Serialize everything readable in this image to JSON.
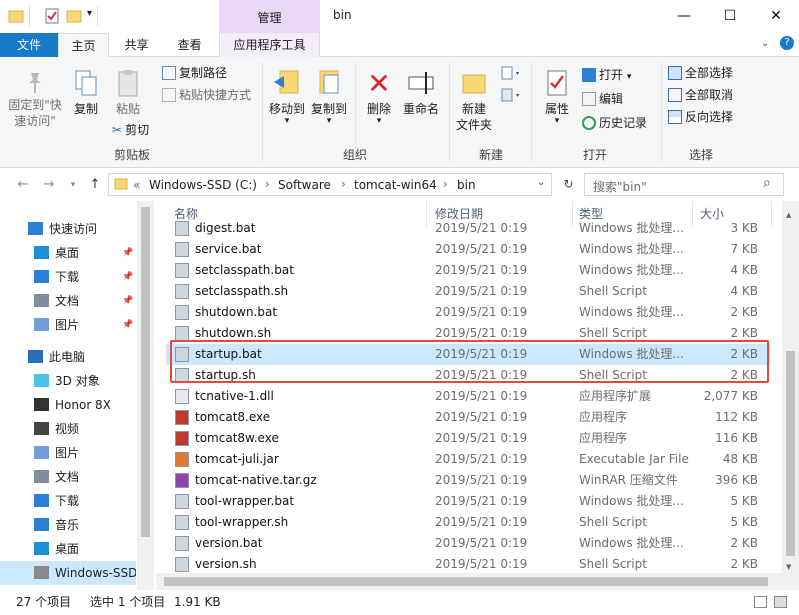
{
  "window": {
    "title": "bin",
    "context_group": "管理",
    "colors": {
      "accent": "#1979ca",
      "context": "#e9d7f6",
      "selection": "#cce8ff",
      "highlight_box": "#e04a3f"
    }
  },
  "tabs": [
    "文件",
    "主页",
    "共享",
    "查看",
    "应用程序工具"
  ],
  "ribbon": {
    "clipboard": {
      "pin": "固定到\"快\n速访问\"",
      "copy": "复制",
      "paste": "粘贴",
      "copy_path": "复制路径",
      "paste_shortcut": "粘贴快捷方式",
      "cut": "剪切",
      "label": "剪贴板"
    },
    "organize": {
      "move_to": "移动到",
      "copy_to": "复制到",
      "delete": "删除",
      "rename": "重命名",
      "label": "组织"
    },
    "new": {
      "new_folder": "新建\n文件夹",
      "label": "新建"
    },
    "open": {
      "properties": "属性",
      "open": "打开",
      "edit": "编辑",
      "history": "历史记录",
      "label": "打开"
    },
    "select": {
      "select_all": "全部选择",
      "select_none": "全部取消",
      "invert": "反向选择",
      "label": "选择"
    }
  },
  "address": {
    "chevron": "«",
    "crumbs": [
      "Windows-SSD (C:)",
      "Software",
      "tomcat-win64",
      "bin"
    ],
    "search_placeholder": "搜索\"bin\""
  },
  "nav": {
    "quick_access": "快速访问",
    "quick_items": [
      "桌面",
      "下载",
      "文档",
      "图片"
    ],
    "this_pc": "此电脑",
    "pc_items": [
      "3D 对象",
      "Honor 8X",
      "视频",
      "图片",
      "文档",
      "下载",
      "音乐",
      "桌面",
      "Windows-SSD"
    ]
  },
  "columns": {
    "name": "名称",
    "date": "修改日期",
    "type": "类型",
    "size": "大小"
  },
  "files": [
    {
      "name": "digest.bat",
      "date": "2019/5/21 0:19",
      "type": "Windows 批处理...",
      "size": "3 KB",
      "icon": "script-icon"
    },
    {
      "name": "service.bat",
      "date": "2019/5/21 0:19",
      "type": "Windows 批处理...",
      "size": "7 KB",
      "icon": "script-icon"
    },
    {
      "name": "setclasspath.bat",
      "date": "2019/5/21 0:19",
      "type": "Windows 批处理...",
      "size": "4 KB",
      "icon": "script-icon"
    },
    {
      "name": "setclasspath.sh",
      "date": "2019/5/21 0:19",
      "type": "Shell Script",
      "size": "4 KB",
      "icon": "script-icon"
    },
    {
      "name": "shutdown.bat",
      "date": "2019/5/21 0:19",
      "type": "Windows 批处理...",
      "size": "2 KB",
      "icon": "script-icon"
    },
    {
      "name": "shutdown.sh",
      "date": "2019/5/21 0:19",
      "type": "Shell Script",
      "size": "2 KB",
      "icon": "script-icon"
    },
    {
      "name": "startup.bat",
      "date": "2019/5/21 0:19",
      "type": "Windows 批处理...",
      "size": "2 KB",
      "icon": "script-icon",
      "selected": true
    },
    {
      "name": "startup.sh",
      "date": "2019/5/21 0:19",
      "type": "Shell Script",
      "size": "2 KB",
      "icon": "script-icon"
    },
    {
      "name": "tcnative-1.dll",
      "date": "2019/5/21 0:19",
      "type": "应用程序扩展",
      "size": "2,077 KB",
      "icon": "dll-icon"
    },
    {
      "name": "tomcat8.exe",
      "date": "2019/5/21 0:19",
      "type": "应用程序",
      "size": "112 KB",
      "icon": "tomcat-icon"
    },
    {
      "name": "tomcat8w.exe",
      "date": "2019/5/21 0:19",
      "type": "应用程序",
      "size": "116 KB",
      "icon": "tomcat-icon"
    },
    {
      "name": "tomcat-juli.jar",
      "date": "2019/5/21 0:19",
      "type": "Executable Jar File",
      "size": "48 KB",
      "icon": "jar-icon"
    },
    {
      "name": "tomcat-native.tar.gz",
      "date": "2019/5/21 0:19",
      "type": "WinRAR 压缩文件",
      "size": "396 KB",
      "icon": "archive-icon"
    },
    {
      "name": "tool-wrapper.bat",
      "date": "2019/5/21 0:19",
      "type": "Windows 批处理...",
      "size": "5 KB",
      "icon": "script-icon"
    },
    {
      "name": "tool-wrapper.sh",
      "date": "2019/5/21 0:19",
      "type": "Shell Script",
      "size": "5 KB",
      "icon": "script-icon"
    },
    {
      "name": "version.bat",
      "date": "2019/5/21 0:19",
      "type": "Windows 批处理...",
      "size": "2 KB",
      "icon": "script-icon"
    },
    {
      "name": "version.sh",
      "date": "2019/5/21 0:19",
      "type": "Shell Script",
      "size": "2 KB",
      "icon": "script-icon"
    }
  ],
  "status": {
    "count": "27 个项目",
    "selected": "选中 1 个项目",
    "size": "1.91 KB"
  }
}
